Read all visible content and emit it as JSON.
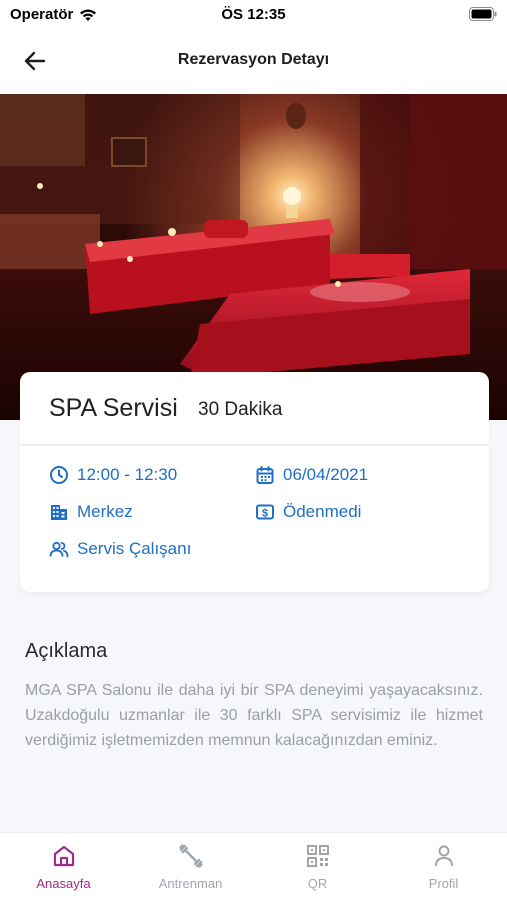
{
  "status_bar": {
    "carrier": "Operatör",
    "time": "ÖS 12:35"
  },
  "header": {
    "title": "Rezervasyon Detayı",
    "back_icon": "arrow-left-icon"
  },
  "service": {
    "name": "SPA Servisi",
    "duration": "30 Dakika",
    "time_range": "12:00 - 12:30",
    "date": "06/04/2021",
    "location": "Merkez",
    "payment_status": "Ödenmedi",
    "staff": "Servis Çalışanı"
  },
  "description": {
    "title": "Açıklama",
    "text": "MGA SPA Salonu ile daha iyi bir SPA deneyimi yaşayacaksınız. Uzakdoğulu uzmanlar ile 30 farklı SPA servisimiz ile hizmet verdiğimiz işletmemizden memnun kalacağınızdan eminiz."
  },
  "tabbar": {
    "tabs": [
      {
        "label": "Anasayfa",
        "icon": "home-icon",
        "active": true
      },
      {
        "label": "Antrenman",
        "icon": "dumbbell-icon",
        "active": false
      },
      {
        "label": "QR",
        "icon": "qr-code-icon",
        "active": false
      },
      {
        "label": "Profil",
        "icon": "user-icon",
        "active": false
      }
    ]
  },
  "colors": {
    "accent_blue": "#1f6fc4",
    "active_tab": "#9b2c8c",
    "inactive_tab": "#a1a6ae"
  }
}
